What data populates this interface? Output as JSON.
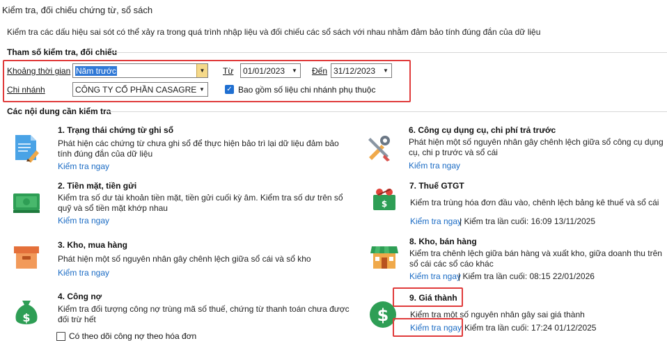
{
  "window": {
    "title": "Kiểm tra, đối chiếu chứng từ, sổ sách",
    "description": "Kiểm tra các dấu hiệu sai sót có thể xảy ra trong quá trình nhập liệu và đối chiếu các sổ sách với nhau nhằm đảm bảo tính đúng đắn của dữ liệu"
  },
  "params": {
    "section_title": "Tham số kiểm tra, đối chiếu",
    "period_label": "Khoảng thời gian",
    "period_value": "Năm trước",
    "from_label": "Từ",
    "from_value": "01/01/2023",
    "to_label": "Đến",
    "to_value": "31/12/2023",
    "branch_label": "Chi nhánh",
    "branch_value": "CÔNG TY CỔ PHẦN CASAGREEN",
    "include_sub_label": "Bao gồm số liệu chi nhánh phụ thuộc",
    "include_sub_checked": true
  },
  "contents": {
    "section_title": "Các nội dung cần kiểm tra",
    "items": [
      {
        "title": "1. Trạng thái chứng từ ghi sổ",
        "desc": "Phát hiện các chứng từ chưa ghi sổ để thực hiện bảo trì lại dữ liệu đảm bảo tính đúng đắn của dữ liệu",
        "link": "Kiểm tra ngay",
        "icon": "document-pencil-icon"
      },
      {
        "title": "2. Tiền mặt, tiền gửi",
        "desc": "Kiểm tra số dư tài khoản tiền mặt, tiền gửi cuối kỳ âm. Kiểm tra số dư trên sổ quỹ và sổ tiền mặt khớp nhau",
        "link": "Kiểm tra ngay",
        "icon": "cash-icon"
      },
      {
        "title": "3. Kho, mua hàng",
        "desc": "Phát hiện một số nguyên nhân gây chênh lệch giữa sổ cái và sổ kho",
        "link": "Kiểm tra ngay",
        "icon": "box-icon"
      },
      {
        "title": "4. Công nợ",
        "desc": "Kiểm tra đối tượng công nợ trùng mã số thuế, chứng từ thanh toán chưa được đối trừ hết",
        "checkbox_label": "Có theo dõi công nợ theo hóa đơn",
        "icon": "money-bag-icon"
      },
      {
        "title": "6. Công cụ dụng cụ, chi phí trả trước",
        "desc": "Phát hiện một số nguyên nhân gây chênh lệch giữa sổ công cụ dụng cụ, chi p trước và sổ cái",
        "link": "Kiểm tra ngay",
        "icon": "tools-icon"
      },
      {
        "title": "7. Thuế GTGT",
        "desc": "Kiểm tra trùng hóa đơn đầu vào, chênh lệch bảng kê thuế và sổ cái",
        "link": "Kiểm tra ngay",
        "last_check": "| Kiểm tra lần cuối: 16:09 13/11/2025",
        "icon": "tax-icon"
      },
      {
        "title": "8. Kho, bán hàng",
        "desc": "Kiểm tra chênh lệch giữa bán hàng và xuất kho, giữa doanh thu trên sổ cái các sổ cáo khác",
        "link": "Kiểm tra ngay",
        "last_check": "| Kiểm tra lần cuối: 08:15 22/01/2026",
        "icon": "store-icon"
      },
      {
        "title": "9. Giá thành",
        "desc": "Kiểm tra một số nguyên nhân gây sai giá thành",
        "link": "Kiểm tra ngay",
        "last_check": "Kiểm tra lần cuối: 17:24 01/12/2025",
        "icon": "dollar-coin-icon"
      }
    ]
  },
  "colors": {
    "accent": "#1a6bc4",
    "highlight_border": "#e03a3a",
    "combo_button": "#f5d98a"
  }
}
